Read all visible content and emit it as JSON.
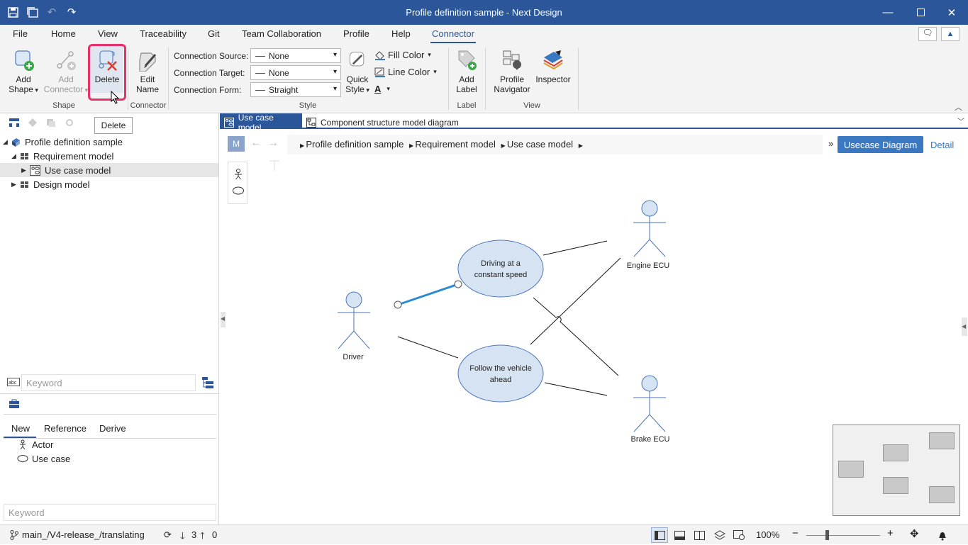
{
  "window": {
    "title": "Profile definition sample - Next Design"
  },
  "menus": [
    "File",
    "Home",
    "View",
    "Traceability",
    "Git",
    "Team Collaboration",
    "Profile",
    "Help",
    "Connector"
  ],
  "ribbon": {
    "add_shape": "Add\nShape",
    "add_shape_l1": "Add",
    "add_shape_l2": "Shape",
    "add_connector_l1": "Add",
    "add_connector_l2": "Connector",
    "delete": "Delete",
    "edit_name_l1": "Edit",
    "edit_name_l2": "Name",
    "connection_source_label": "Connection Source:",
    "connection_source_value": "None",
    "connection_target_label": "Connection Target:",
    "connection_target_value": "None",
    "connection_form_label": "Connection Form:",
    "connection_form_value": "Straight",
    "quick_style_l1": "Quick",
    "quick_style_l2": "Style",
    "fill_color": "Fill Color",
    "line_color": "Line Color",
    "font_color_glyph": "A",
    "add_label_l1": "Add",
    "add_label_l2": "Label",
    "profile_navigator_l1": "Profile",
    "profile_navigator_l2": "Navigator",
    "inspector": "Inspector",
    "groups": {
      "shape": "Shape",
      "connector": "Connector",
      "style": "Style",
      "label": "Label",
      "view": "View"
    }
  },
  "tooltip": "Delete",
  "tree": {
    "root": "Profile definition sample",
    "requirement": "Requirement model",
    "usecase": "Use case model",
    "design": "Design model"
  },
  "keyword_placeholder": "Keyword",
  "lower_tabs": [
    "New",
    "Reference",
    "Derive"
  ],
  "new_items": [
    "Actor",
    "Use case"
  ],
  "doc_tabs": [
    "Use case model",
    "Component structure model diagram"
  ],
  "breadcrumb": {
    "items": [
      "Profile definition sample",
      "Requirement model",
      "Use case model"
    ],
    "m_badge": "M"
  },
  "usecase_button": "Usecase Diagram",
  "detail_link": "Detail",
  "diagram": {
    "actors": [
      "Driver",
      "Engine ECU",
      "Brake ECU"
    ],
    "usecases": [
      "Driving at a",
      "constant speed",
      "Follow the vehicle",
      "ahead"
    ]
  },
  "status": {
    "branch": "main_/V4-release_/translating",
    "down": "3",
    "up": "0",
    "zoom": "100%"
  },
  "colors": {
    "accent": "#2b579a",
    "highlight": "#e8306b",
    "selected_connector": "#2a8bd3"
  }
}
